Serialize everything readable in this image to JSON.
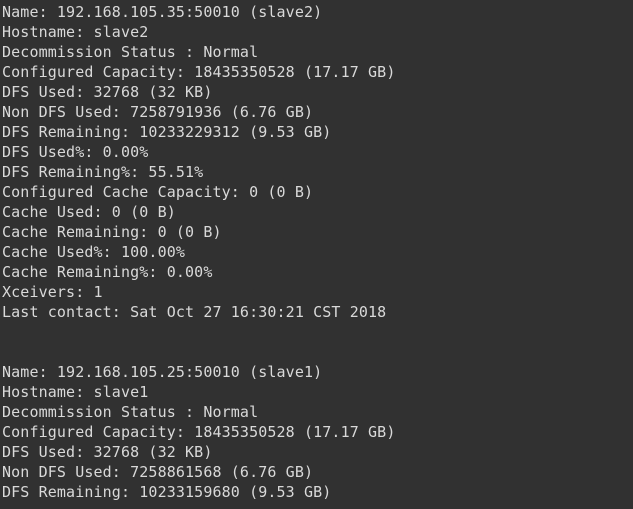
{
  "terminal": {
    "background_color": "#313131",
    "text_color": "#d9d9d9",
    "blocks": [
      {
        "id": "datanode-slave2",
        "lines": [
          "Name: 192.168.105.35:50010 (slave2)",
          "Hostname: slave2",
          "Decommission Status : Normal",
          "Configured Capacity: 18435350528 (17.17 GB)",
          "DFS Used: 32768 (32 KB)",
          "Non DFS Used: 7258791936 (6.76 GB)",
          "DFS Remaining: 10233229312 (9.53 GB)",
          "DFS Used%: 0.00%",
          "DFS Remaining%: 55.51%",
          "Configured Cache Capacity: 0 (0 B)",
          "Cache Used: 0 (0 B)",
          "Cache Remaining: 0 (0 B)",
          "Cache Used%: 100.00%",
          "Cache Remaining%: 0.00%",
          "Xceivers: 1",
          "Last contact: Sat Oct 27 16:30:21 CST 2018"
        ]
      },
      {
        "id": "separator-1",
        "lines": [
          "",
          ""
        ]
      },
      {
        "id": "datanode-slave1",
        "lines": [
          "Name: 192.168.105.25:50010 (slave1)",
          "Hostname: slave1",
          "Decommission Status : Normal",
          "Configured Capacity: 18435350528 (17.17 GB)",
          "DFS Used: 32768 (32 KB)",
          "Non DFS Used: 7258861568 (6.76 GB)",
          "DFS Remaining: 10233159680 (9.53 GB)"
        ]
      }
    ]
  }
}
